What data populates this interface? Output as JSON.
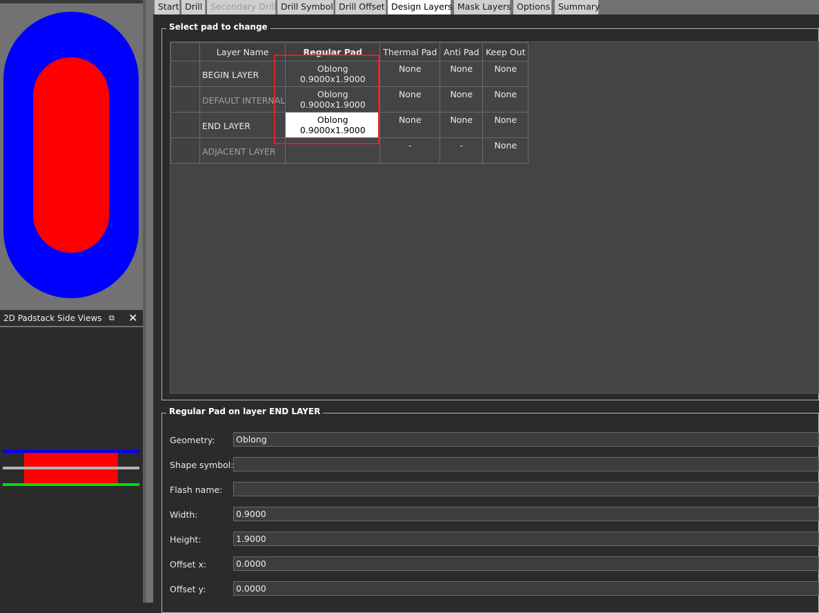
{
  "tabs": [
    {
      "label": "Start",
      "state": "normal"
    },
    {
      "label": "Drill",
      "state": "normal"
    },
    {
      "label": "Secondary Drill",
      "state": "disabled"
    },
    {
      "label": "Drill Symbol",
      "state": "normal"
    },
    {
      "label": "Drill Offset",
      "state": "normal"
    },
    {
      "label": "Design Layers",
      "state": "active"
    },
    {
      "label": "Mask Layers",
      "state": "normal"
    },
    {
      "label": "Options",
      "state": "normal"
    },
    {
      "label": "Summary",
      "state": "normal"
    }
  ],
  "side_views": {
    "title": "2D Padstack Side Views",
    "float_glyph": "⧉",
    "close_glyph": "✕"
  },
  "select_pad": {
    "title": "Select pad to change",
    "columns": [
      "Layer Name",
      "Regular Pad",
      "Thermal Pad",
      "Anti Pad",
      "Keep Out"
    ],
    "rows": [
      {
        "layer": "BEGIN LAYER",
        "regular": "Oblong 0.9000x1.9000",
        "thermal": "None",
        "anti": "None",
        "keepout": "None",
        "dim": false,
        "selected": false
      },
      {
        "layer": "DEFAULT INTERNAL",
        "regular": "Oblong 0.9000x1.9000",
        "thermal": "None",
        "anti": "None",
        "keepout": "None",
        "dim": true,
        "selected": false
      },
      {
        "layer": "END LAYER",
        "regular": "Oblong 0.9000x1.9000",
        "thermal": "None",
        "anti": "None",
        "keepout": "None",
        "dim": false,
        "selected": true
      },
      {
        "layer": "ADJACENT LAYER",
        "regular": "",
        "thermal": "-",
        "anti": "-",
        "keepout": "None",
        "dim": true,
        "selected": false
      }
    ]
  },
  "pad_detail": {
    "title": "Regular Pad on layer END LAYER",
    "fields": [
      {
        "label": "Geometry:",
        "value": "Oblong"
      },
      {
        "label": "Shape symbol:",
        "value": ""
      },
      {
        "label": "Flash name:",
        "value": ""
      },
      {
        "label": "Width:",
        "value": "0.9000"
      },
      {
        "label": "Height:",
        "value": "1.9000"
      },
      {
        "label": "Offset x:",
        "value": "0.0000"
      },
      {
        "label": "Offset y:",
        "value": "0.0000"
      }
    ]
  },
  "colors": {
    "pad_outer": "#0000ff",
    "pad_inner": "#ff0000",
    "begin_layer_line": "#0000ff",
    "internal_layer_line": "#b4b4b4",
    "end_layer_line": "#00e000",
    "highlight": "#d9232a"
  }
}
